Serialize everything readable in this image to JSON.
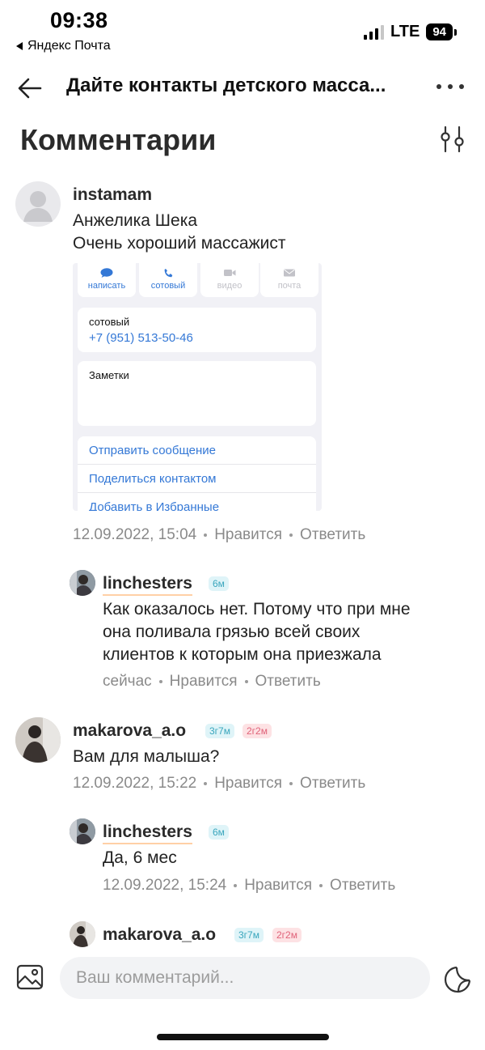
{
  "status_bar": {
    "time": "09:38",
    "back_app": "Яндекс Почта",
    "network": "LTE",
    "battery": "94"
  },
  "header": {
    "title": "Дайте контакты детского масса..."
  },
  "page": {
    "title": "Комментарии"
  },
  "comments": [
    {
      "username": "instamam",
      "lines": [
        "Анжелика Шека",
        "Очень хороший массажист"
      ],
      "attachment": {
        "buttons": [
          "написать",
          "сотовый",
          "видео",
          "почта"
        ],
        "phone_label": "сотовый",
        "phone": "+7 (951) 513-50-46",
        "notes_label": "Заметки",
        "actions": [
          "Отправить сообщение",
          "Поделиться контактом",
          "Добавить в Избранные"
        ]
      },
      "time": "12.09.2022, 15:04",
      "like": "Нравится",
      "reply": "Ответить"
    },
    {
      "username": "linchesters",
      "badge": "6м",
      "lines": [
        "Как оказалось нет. Потому что при мне",
        "она поливала грязью всей своих",
        "клиентов к которым она приезжала"
      ],
      "time": "сейчас",
      "like": "Нравится",
      "reply": "Ответить"
    },
    {
      "username": "makarova_a.o",
      "badges": [
        "3г7м",
        "2г2м"
      ],
      "lines": [
        "Вам для малыша?"
      ],
      "time": "12.09.2022, 15:22",
      "like": "Нравится",
      "reply": "Ответить"
    },
    {
      "username": "linchesters",
      "badge": "6м",
      "lines": [
        "Да, 6 мес"
      ],
      "time": "12.09.2022, 15:24",
      "like": "Нравится",
      "reply": "Ответить"
    },
    {
      "username": "makarova_a.o",
      "badges": [
        "3г7м",
        "2г2м"
      ]
    }
  ],
  "input": {
    "placeholder": "Ваш комментарий..."
  },
  "colors": {
    "badge_teal": "#3aa6bd",
    "badge_pink": "#e0637a",
    "link_blue": "#3478d6",
    "meta_gray": "#8a8a8a"
  }
}
